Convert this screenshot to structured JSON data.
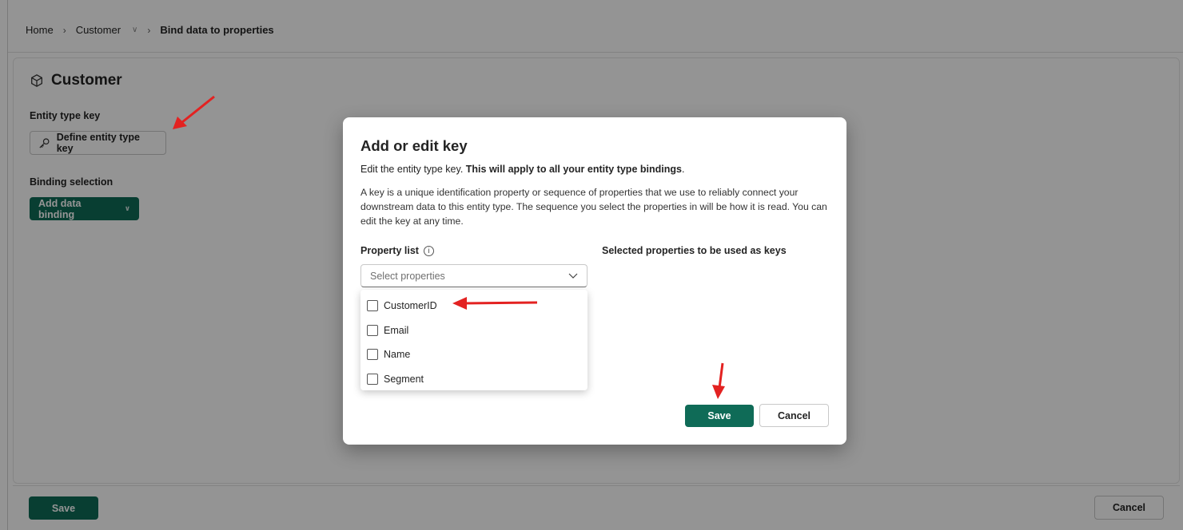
{
  "breadcrumb": {
    "home": "Home",
    "customer": "Customer",
    "current": "Bind data to properties"
  },
  "entity": {
    "title": "Customer",
    "key_label": "Entity type key",
    "define_key_button": "Define entity type key",
    "binding_label": "Binding selection",
    "add_binding_button": "Add data binding"
  },
  "footer": {
    "save": "Save",
    "cancel": "Cancel"
  },
  "dialog": {
    "title": "Add or edit key",
    "subtitle_plain": "Edit the entity type key. ",
    "subtitle_bold": "This will apply to all your entity type bindings",
    "subtitle_end": ".",
    "description": "A key is a unique identification property or sequence of properties that we use to reliably connect your downstream data to this entity type. The sequence you select the properties in will be how it is read. You can edit the key at any time.",
    "property_list_label": "Property list",
    "selected_label": "Selected properties to be used as keys",
    "select_placeholder": "Select properties",
    "options": [
      {
        "label": "CustomerID",
        "checked": false
      },
      {
        "label": "Email",
        "checked": false
      },
      {
        "label": "Name",
        "checked": false
      },
      {
        "label": "Segment",
        "checked": false
      }
    ],
    "save": "Save",
    "cancel": "Cancel"
  },
  "colors": {
    "accent": "#0f6b57",
    "annotation_arrow": "#e32221"
  }
}
